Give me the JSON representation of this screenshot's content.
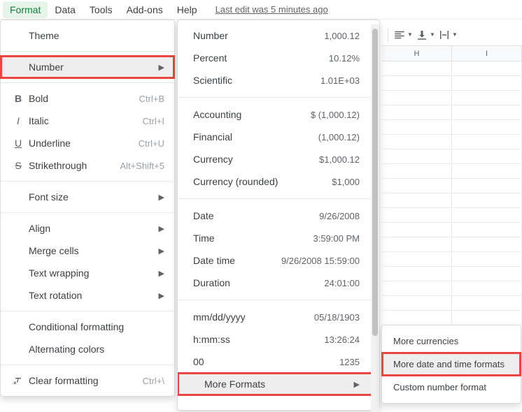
{
  "menubar": {
    "format": "Format",
    "data": "Data",
    "tools": "Tools",
    "addons": "Add-ons",
    "help": "Help",
    "last_edit": "Last edit was 5 minutes ago"
  },
  "columns": [
    "H",
    "I"
  ],
  "format_menu": {
    "theme": "Theme",
    "number": "Number",
    "bold": {
      "label": "Bold",
      "shortcut": "Ctrl+B"
    },
    "italic": {
      "label": "Italic",
      "shortcut": "Ctrl+I"
    },
    "underline": {
      "label": "Underline",
      "shortcut": "Ctrl+U"
    },
    "strike": {
      "label": "Strikethrough",
      "shortcut": "Alt+Shift+5"
    },
    "font_size": "Font size",
    "align": "Align",
    "merge": "Merge cells",
    "wrap": "Text wrapping",
    "rotation": "Text rotation",
    "conditional": "Conditional formatting",
    "alternating": "Alternating colors",
    "clear": {
      "label": "Clear formatting",
      "shortcut": "Ctrl+\\"
    }
  },
  "number_menu": {
    "number": {
      "label": "Number",
      "example": "1,000.12"
    },
    "percent": {
      "label": "Percent",
      "example": "10.12%"
    },
    "scientific": {
      "label": "Scientific",
      "example": "1.01E+03"
    },
    "accounting": {
      "label": "Accounting",
      "example": "$ (1,000.12)"
    },
    "financial": {
      "label": "Financial",
      "example": "(1,000.12)"
    },
    "currency": {
      "label": "Currency",
      "example": "$1,000.12"
    },
    "currency_r": {
      "label": "Currency (rounded)",
      "example": "$1,000"
    },
    "date": {
      "label": "Date",
      "example": "9/26/2008"
    },
    "time": {
      "label": "Time",
      "example": "3:59:00 PM"
    },
    "datetime": {
      "label": "Date time",
      "example": "9/26/2008 15:59:00"
    },
    "duration": {
      "label": "Duration",
      "example": "24:01:00"
    },
    "custom1": {
      "label": "mm/dd/yyyy",
      "example": "05/18/1903"
    },
    "custom2": {
      "label": "h:mm:ss",
      "example": "13:26:24"
    },
    "custom3": {
      "label": "00",
      "example": "1235"
    },
    "more": "More Formats"
  },
  "more_menu": {
    "currencies": "More currencies",
    "datetime": "More date and time formats",
    "custom": "Custom number format"
  }
}
